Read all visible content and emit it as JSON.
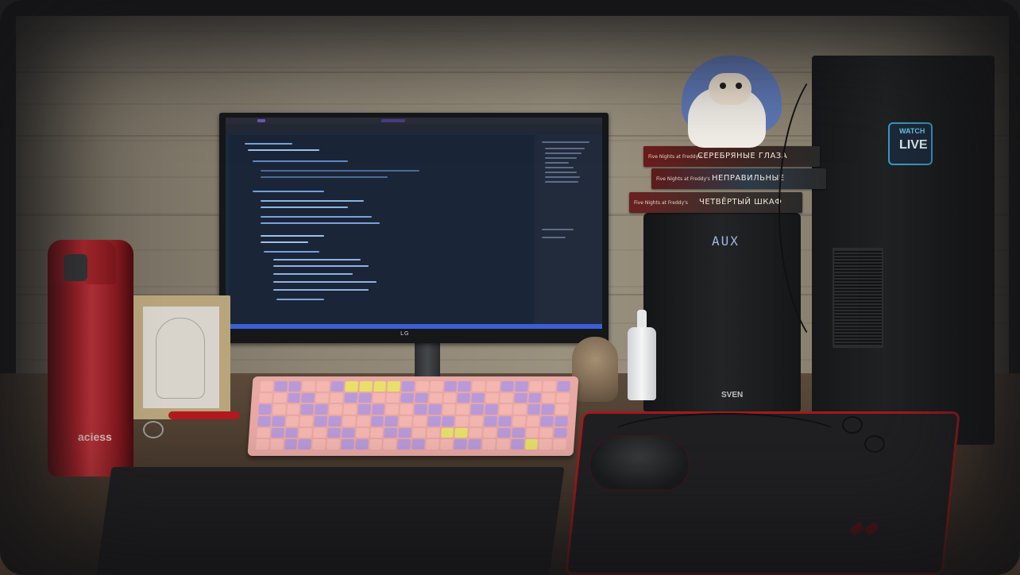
{
  "monitor": {
    "brand": "LG",
    "screen_theme_colors": {
      "background": "#1e2a3d",
      "statusbar": "#3c5fd6",
      "accent": "#6b5bb8"
    }
  },
  "thermos": {
    "label": "aciess"
  },
  "books": [
    {
      "title": "СЕРЕБРЯНЫЕ ГЛАЗА",
      "series": "Five Nights at Freddy's"
    },
    {
      "title": "НЕПРАВИЛЬНЫЕ",
      "series": "Five Nights at Freddy's"
    },
    {
      "title": "ЧЕТВЁРТЫЙ ШКАФ",
      "series": "Five Nights at Freddy's"
    }
  ],
  "speaker": {
    "display": "AUX",
    "brand": "SVEN"
  },
  "pc_sticker": {
    "top": "WATCH",
    "bottom": "LIVE"
  },
  "colors": {
    "keyboard_case": "#e8a8a4",
    "thermos": "#b3232b",
    "mousepad_border": "#a21a1e"
  }
}
